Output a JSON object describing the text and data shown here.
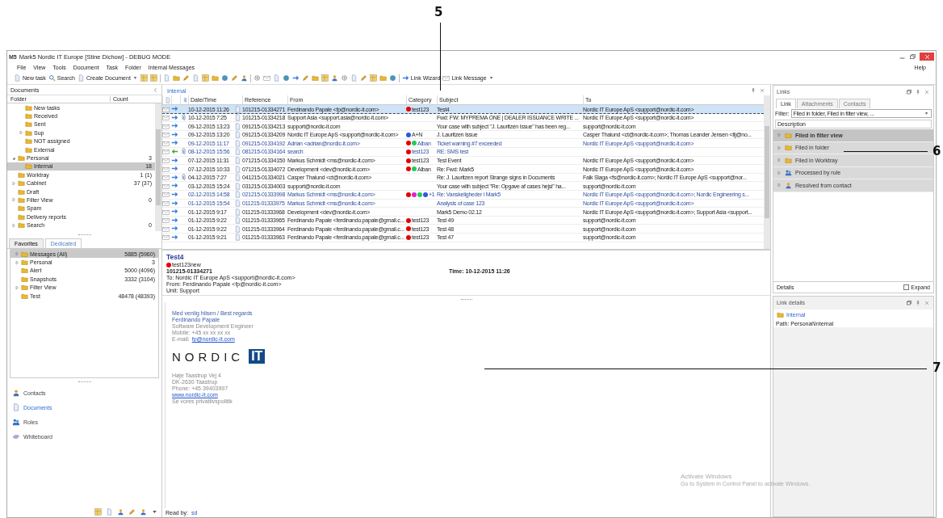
{
  "callouts": [
    {
      "label": "5"
    },
    {
      "label": "6"
    },
    {
      "label": "7"
    }
  ],
  "window": {
    "title": "Mark5 Nordic IT Europe [Stine Dichow] - DEBUG MODE",
    "logo": "M5"
  },
  "menu": {
    "items": [
      "File",
      "View",
      "Tools",
      "Document",
      "Task",
      "Folder",
      "Internal Messages"
    ],
    "help": "Help"
  },
  "toolbar": {
    "new_task": "New task",
    "search": "Search",
    "create_document": "Create Document",
    "link_wizard": "Link Wizard",
    "link_message": "Link Message"
  },
  "documents": {
    "title": "Documents",
    "columns": [
      "Folder",
      "Count"
    ],
    "continued": [
      {
        "label": "New tasks",
        "selected": false
      },
      {
        "label": "Received",
        "selected": false
      },
      {
        "label": "Sent",
        "selected": false
      },
      {
        "label": "Sup",
        "expanded": false,
        "selected": false
      },
      {
        "label": "NOT assigned",
        "selected": false
      },
      {
        "label": "External",
        "selected": false
      }
    ],
    "items": [
      {
        "label": "Personal",
        "count": "3",
        "expanded": true,
        "selected": false,
        "children": [
          {
            "label": "Internal",
            "count": "18",
            "selected": true
          }
        ]
      },
      {
        "label": "Worktray",
        "count": "1 (1)",
        "selected": false
      },
      {
        "label": "Cabinet",
        "count": "37 (37)",
        "expanded": false,
        "selected": false
      },
      {
        "label": "Draft",
        "selected": false
      },
      {
        "label": "Filter View",
        "count": "0",
        "expanded": false,
        "selected": false
      },
      {
        "label": "Spam",
        "selected": false
      },
      {
        "label": "Delivery reports",
        "selected": false
      },
      {
        "label": "Search",
        "count": "0",
        "expanded": false,
        "selected": false
      }
    ]
  },
  "favorites": {
    "tabs": [
      {
        "label": "Favorites",
        "selected": false
      },
      {
        "label": "Dedicated",
        "selected": true
      }
    ],
    "items": [
      {
        "label": "Messages (All)",
        "count": "5885 (5960)",
        "expanded": false,
        "selected": true
      },
      {
        "label": "Personal",
        "count": "3",
        "expanded": false,
        "selected": false
      },
      {
        "label": "Alert",
        "count": "5000 (4096)",
        "selected": false
      },
      {
        "label": "Snapshots",
        "count": "3332 (3104)",
        "selected": false
      },
      {
        "label": "Filter View",
        "expanded": false,
        "selected": false
      },
      {
        "label": "Test",
        "count": "48478 (48393)",
        "selected": false
      }
    ]
  },
  "navigation": [
    {
      "label": "Contacts",
      "selected": false
    },
    {
      "label": "Documents",
      "selected": true
    },
    {
      "label": "Roles",
      "selected": false
    },
    {
      "label": "Whiteboard",
      "selected": false
    }
  ],
  "list": {
    "title": "Internal",
    "columns": [
      "Date/Time",
      "Reference",
      "From",
      "Category",
      "Subject",
      "To"
    ],
    "rows": [
      {
        "date": "10-12-2015 11:26",
        "reference": "101215-01334271",
        "from": "Ferdinando Papale <fp@nordic-it.com>",
        "category": {
          "dots": [
            {
              "color": "#e60000"
            }
          ],
          "label": "test123"
        },
        "subject": "Test4",
        "to": "Nordic IT Europe ApS <support@nordic-it.com>",
        "kind": "outgoing",
        "attachment": false,
        "muted": false,
        "selected": true
      },
      {
        "date": "10-12-2015 7:25",
        "reference": "101215-01334218",
        "from": "Support Asia <support.asia@nordic-it.com>",
        "subject": "Fwd: FW: MYPREMA ONE | DEALER ISSUANCE  WRITE ...",
        "to": "Nordic IT Europe ApS <support@nordic-it.com>",
        "kind": "outgoing",
        "attachment": true,
        "muted": false,
        "selected": false
      },
      {
        "date": "09-12-2015 13:23",
        "reference": "091215-01334213",
        "from": "support@nordic-it.com",
        "subject": "Your case with subject \"J. Lauritzen Issue\" has been reg...",
        "to": "support@nordic-it.com",
        "kind": "outgoing",
        "attachment": false,
        "muted": false,
        "selected": false
      },
      {
        "date": "09-12-2015 13:20",
        "reference": "091215-01334209",
        "from": "Nordic IT Europe ApS <support@nordic-it.com>",
        "category": {
          "dots": [
            {
              "color": "#3355dd"
            }
          ],
          "label": "A+N"
        },
        "subject": "J. Lauritzen Issue",
        "to": "Casper Thalund <ct@nordic-it.com>; Thomas Leander Jensen <tlj@no...",
        "kind": "outgoing",
        "attachment": false,
        "muted": false,
        "selected": false
      },
      {
        "date": "09-12-2015 11:17",
        "reference": "091215-01334192",
        "from": "Adrian <adrian@nordic-it.com>",
        "category": {
          "dots": [
            {
              "color": "#e60000"
            },
            {
              "color": "#22cc55"
            }
          ],
          "label": "Alban"
        },
        "subject": "Ticket warning #7 exceeded",
        "to": "Nordic IT Europe ApS <support@nordic-it.com>",
        "kind": "outgoing",
        "attachment": false,
        "muted": true,
        "selected": false
      },
      {
        "date": "08-12-2015 15:56",
        "reference": "081215-01334164",
        "from": "search",
        "category": {
          "dots": [
            {
              "color": "#e60000"
            }
          ],
          "label": "test123"
        },
        "subject": "RE: SMS test",
        "kind": "incoming",
        "attachment": true,
        "muted": true,
        "selected": false
      },
      {
        "date": "07-12-2015 11:31",
        "reference": "071215-01334150",
        "from": "Markus Schmidt <ms@nordic-it.com>",
        "category": {
          "dots": [
            {
              "color": "#e60000"
            }
          ],
          "label": "test123"
        },
        "subject": "Test Event",
        "to": "Nordic IT Europe ApS <support@nordic-it.com>",
        "kind": "outgoing",
        "attachment": false,
        "muted": false,
        "selected": false
      },
      {
        "date": "07-12-2015 10:33",
        "reference": "071215-01334072",
        "from": "Development <dev@nordic-it.com>",
        "category": {
          "dots": [
            {
              "color": "#e60000"
            },
            {
              "color": "#22cc55"
            }
          ],
          "label": "Alban"
        },
        "subject": "Re: Fwd: Mark5",
        "to": "Nordic IT Europe ApS <support@nordic-it.com>",
        "kind": "outgoing",
        "attachment": false,
        "muted": false,
        "selected": false
      },
      {
        "date": "04-12-2015 7:27",
        "reference": "041215-01334021",
        "from": "Casper Thalund <ct@nordic-it.com>",
        "subject": "Re: J. Lauritzen report Strange signs in Documents",
        "to": "Falk Slaga <fs@nordic-it.com>;  Nordic IT Europe ApS <support@nor...",
        "kind": "outgoing",
        "attachment": true,
        "muted": false,
        "selected": false
      },
      {
        "date": "03-12-2015 15:24",
        "reference": "031215-01334003",
        "from": "support@nordic-it.com",
        "subject": "Your case with subject \"Re: Opgave af cases hejsi\" ha...",
        "to": "support@nordic-it.com",
        "kind": "outgoing",
        "attachment": false,
        "muted": false,
        "selected": false
      },
      {
        "date": "02-12-2015 14:58",
        "reference": "021215-01333998",
        "from": "Markus Schmidt <ms@nordic-it.com>",
        "category": {
          "dots": [
            {
              "color": "#e60000"
            },
            {
              "color": "#dd22cc"
            },
            {
              "color": "#22cc55"
            },
            {
              "color": "#3355dd"
            }
          ],
          "label": "+1"
        },
        "subject": "Re: Vanskeligheder i Mark5",
        "to": "Nordic IT Europe ApS <support@nordic-it.com>;  Nordic Engineering s...",
        "kind": "outgoing",
        "attachment": false,
        "muted": true,
        "selected": false
      },
      {
        "date": "01-12-2015 15:54",
        "reference": "011215-01333975",
        "from": "Markus Schmidt <ms@nordic-it.com>",
        "subject": "Analysis of case 123",
        "to": "Nordic IT Europe ApS <support@nordic-it.com>",
        "kind": "outgoing",
        "attachment": false,
        "muted": true,
        "selected": false
      },
      {
        "date": "01-12-2015 9:17",
        "reference": "011215-01333968",
        "from": "Development <dev@nordic-it.com>",
        "subject": "Mark5 Demo 02.12",
        "to": "Nordic IT Europe ApS <support@nordic-it.com>; Support Asia <support...",
        "kind": "outgoing",
        "attachment": false,
        "muted": false,
        "selected": false
      },
      {
        "date": "01-12-2015 9:22",
        "reference": "011215-01333965",
        "from": "Ferdinando Papale <ferdinando.papale@gmail.c...",
        "category": {
          "dots": [
            {
              "color": "#e60000"
            }
          ],
          "label": "test123"
        },
        "subject": "Test 49",
        "to": "support@nordic-it.com",
        "kind": "outgoing",
        "attachment": false,
        "muted": false,
        "selected": false
      },
      {
        "date": "01-12-2015 9:22",
        "reference": "011215-01333964",
        "from": "Ferdinando Papale <ferdinando.papale@gmail.c...",
        "category": {
          "dots": [
            {
              "color": "#e60000"
            }
          ],
          "label": "test123"
        },
        "subject": "Test 48",
        "to": "support@nordic-it.com",
        "kind": "outgoing",
        "attachment": false,
        "muted": false,
        "selected": false
      },
      {
        "date": "01-12-2015 9:21",
        "reference": "011215-01333963",
        "from": "Ferdinando Papale <ferdinando.papale@gmail.c...",
        "category": {
          "dots": [
            {
              "color": "#e60000"
            }
          ],
          "label": "test123"
        },
        "subject": "Test 47",
        "to": "support@nordic-it.com",
        "kind": "outgoing",
        "attachment": false,
        "muted": false,
        "selected": false
      }
    ]
  },
  "preview": {
    "subject": "Test4",
    "category": {
      "color": "#e60000",
      "label": "test123new"
    },
    "reference": "101215-01334271",
    "time": "Time: 10-12-2015 11:26",
    "to": "To:   Nordic IT Europe ApS <support@nordic-it.com>",
    "from": "From: Ferdinando Papale <fp@nordic-it.com>",
    "unit": "Unit: Support",
    "body": {
      "greeting": "Med venlig hilsen / Best regards",
      "name": "Ferdinando Papale",
      "role": "Software Development Engineer",
      "mobile": "Mobile: +45 xx xx xx xx",
      "email_label": "E-mail:",
      "email": "fp@nordic-it.com",
      "logo_word": "NORDIC",
      "logo_mark": "IT",
      "address": [
        "Høje Taastrup Vej 4",
        "DK-2630 Taastrup",
        "Phone: +45 39403997"
      ],
      "website": "www.nordic-it.com",
      "footer": "Se vores privatlivspolitik"
    }
  },
  "status": {
    "read_by_label": "Read by:",
    "read_by": "sd"
  },
  "links": {
    "title": "Links",
    "tabs": [
      {
        "label": "Link",
        "selected": true
      },
      {
        "label": "Attachments",
        "selected": false
      },
      {
        "label": "Contacts",
        "selected": false
      }
    ],
    "filter_label": "Filter:",
    "filter_value": "Filed in folder, Filed in filter view, ...",
    "column": "Description",
    "items": [
      {
        "label": "Filed in filter view",
        "selected": true
      },
      {
        "label": "Filed in folder",
        "selected": false
      },
      {
        "label": "Filed in Worktray",
        "selected": false
      },
      {
        "label": "Processed by rule",
        "selected": false
      },
      {
        "label": "Resolved from contact",
        "selected": false
      }
    ],
    "details": "Details",
    "expand": {
      "label": "Expand",
      "checked": false
    }
  },
  "link_details": {
    "title": "Link details",
    "folder": "Internal",
    "path": "Path:  Personal\\Internal"
  },
  "activation": {
    "title": "Activate Windows",
    "text": "Go to System in Control Panel to activate Windows."
  }
}
